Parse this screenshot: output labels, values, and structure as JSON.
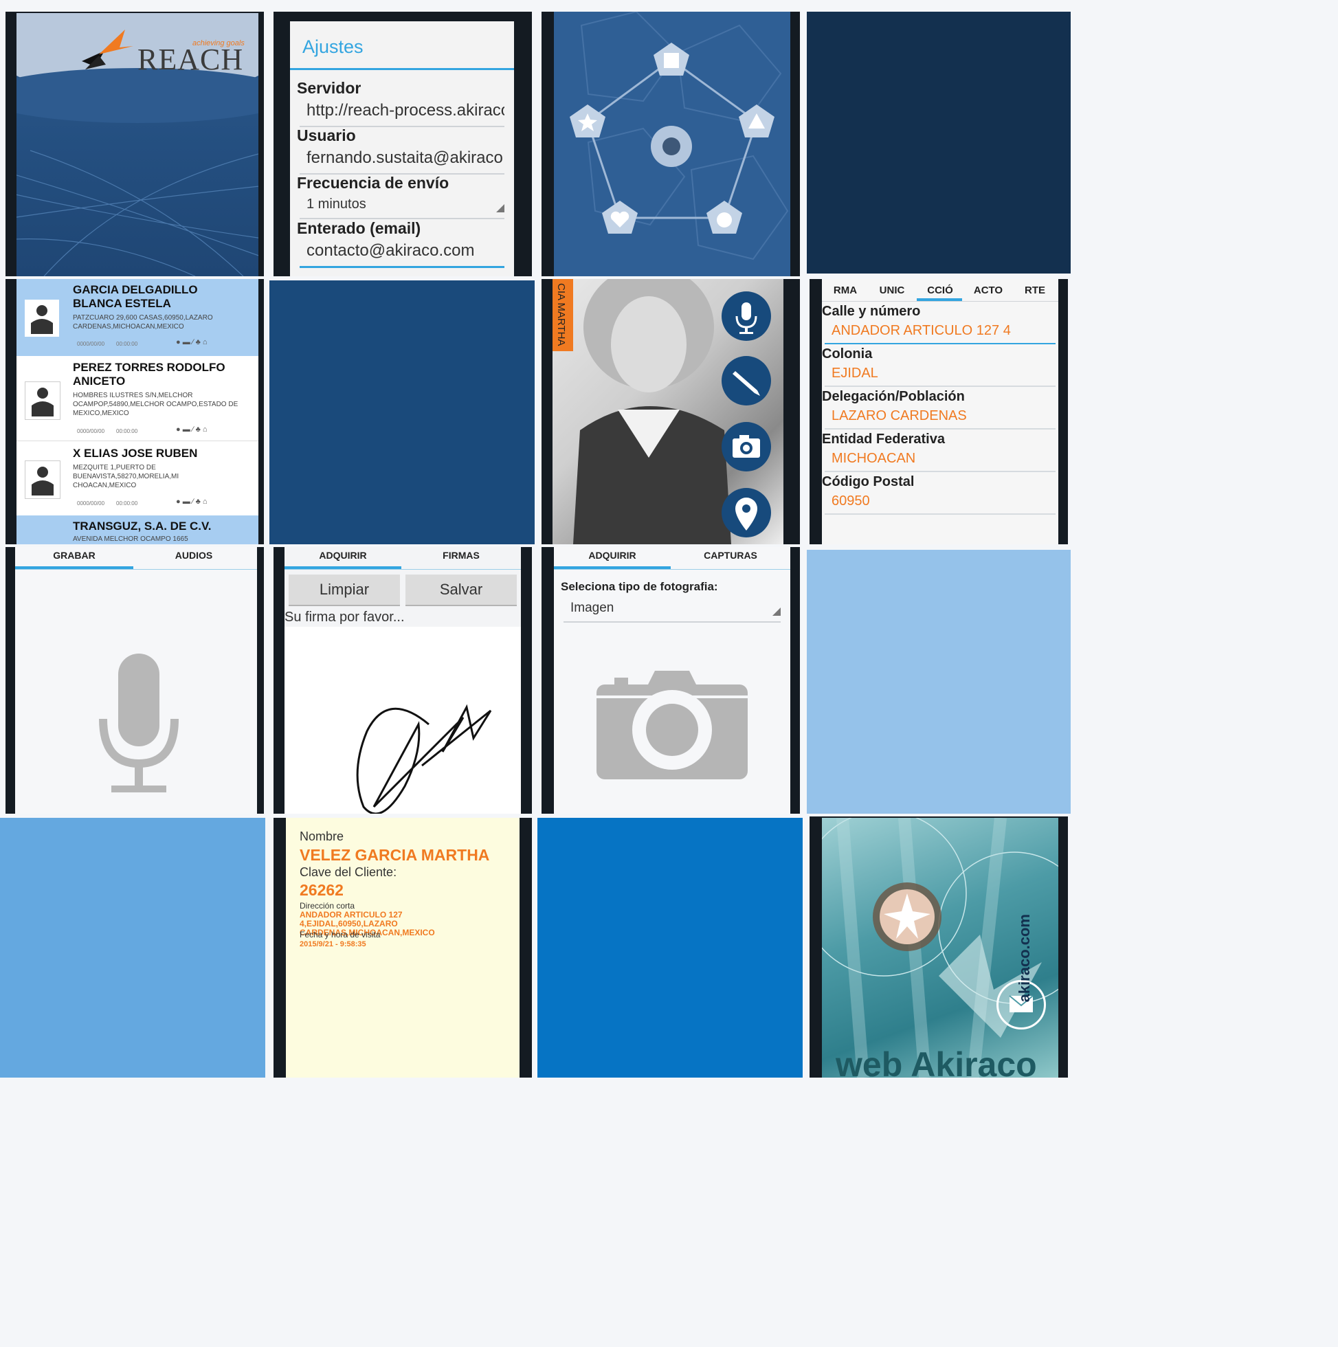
{
  "splash": {
    "brand": "REACH",
    "tagline": "achieving goals"
  },
  "settings": {
    "title": "Ajustes",
    "fields": [
      {
        "label": "Servidor",
        "value": "http://reach-process.akiraco.com"
      },
      {
        "label": "Usuario",
        "value": "fernando.sustaita@akiraco.com"
      },
      {
        "label": "Frecuencia de envío",
        "value": "1 minutos"
      },
      {
        "label": "Enterado (email)",
        "value": "contacto@akiraco.com"
      }
    ]
  },
  "pentagon_icons": [
    "square-icon",
    "triangle-icon",
    "circle-icon",
    "heart-icon",
    "star-icon",
    "center-circle-icon"
  ],
  "clients": [
    {
      "name": "GARCIA DELGADILLO BLANCA ESTELA",
      "address": "PATZCUARO 29,600 CASAS,60950,LAZARO CARDENAS,MICHOACAN,MEXICO",
      "date": "0000/00/00",
      "time": "00:00:00",
      "selected": true
    },
    {
      "name": "PEREZ TORRES RODOLFO ANICETO",
      "address": "HOMBRES ILUSTRES S/N,MELCHOR OCAMPOP,54890,MELCHOR OCAMPO,ESTADO DE MEXICO,MEXICO",
      "date": "0000/00/00",
      "time": "00:00:00",
      "selected": false
    },
    {
      "name": "X ELIAS JOSE RUBEN",
      "address": "MEZQUITE 1,PUERTO DE BUENAVISTA,58270,MORELIA,MI CHOACAN,MEXICO",
      "date": "0000/00/00",
      "time": "00:00:00",
      "selected": false
    },
    {
      "name": "TRANSGUZ, S.A. DE C.V.",
      "address": "AVENIDA MELCHOR OCAMPO 1665",
      "date": "",
      "time": "",
      "selected": true
    }
  ],
  "profile": {
    "side_label": "CIA MARTHA",
    "actions": [
      "microphone-icon",
      "pen-icon",
      "camera-icon",
      "location-pin-icon"
    ]
  },
  "address_form": {
    "tabs": [
      "RMA",
      "UNIC",
      "CCIÓ",
      "ACTO",
      "RTE"
    ],
    "active_tab": 2,
    "fields": [
      {
        "label": "Calle y número",
        "value": "ANDADOR ARTICULO 127 4"
      },
      {
        "label": "Colonia",
        "value": "EJIDAL"
      },
      {
        "label": "Delegación/Población",
        "value": "LAZARO CARDENAS"
      },
      {
        "label": "Entidad Federativa",
        "value": "MICHOACAN"
      },
      {
        "label": "Código Postal",
        "value": "60950"
      }
    ]
  },
  "audio": {
    "tabs": [
      "GRABAR",
      "AUDIOS"
    ]
  },
  "signature": {
    "tabs": [
      "ADQUIRIR",
      "FIRMAS"
    ],
    "clear": "Limpiar",
    "save": "Salvar",
    "prompt": "Su firma por favor..."
  },
  "photo": {
    "tabs": [
      "ADQUIRIR",
      "CAPTURAS"
    ],
    "label": "Seleciona tipo de fotografia:",
    "select": "Imagen"
  },
  "client_info": {
    "name_label": "Nombre",
    "name": "VELEZ GARCIA MARTHA",
    "key_label": "Clave del Cliente:",
    "key": "26262",
    "address_label": "Dirección corta",
    "address": "ANDADOR ARTICULO 127 4,EJIDAL,60950,LAZARO CARDENAS,MICHOACAN,MEXICO",
    "visit_label": "Fecha y hora de visita",
    "visit": "2015/9/21 - 9:58:35"
  },
  "web": {
    "domain": "akiraco.com",
    "title": "web Akiraco"
  },
  "colors": {
    "dark_navy": "#13304f",
    "navy": "#1a4a7b",
    "light_blue": "#95c2ea",
    "sky": "#64a8e0",
    "brand_blue": "#0674c4",
    "orange": "#f07a21",
    "teal": "#3a98a8"
  }
}
